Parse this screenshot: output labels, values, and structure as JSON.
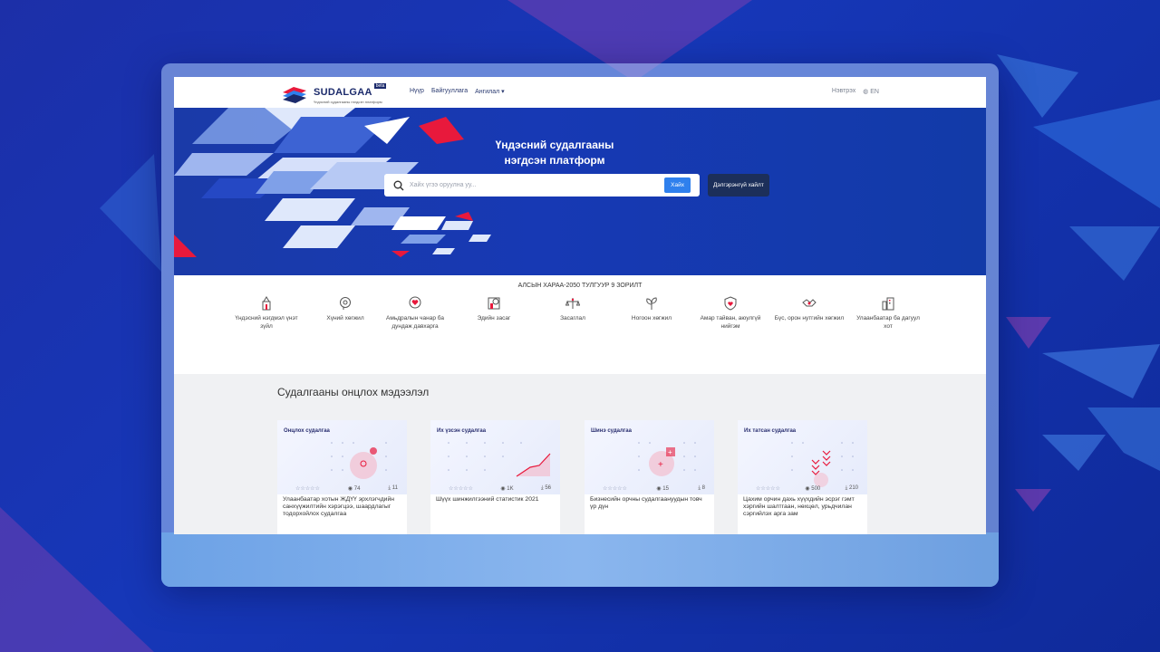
{
  "header": {
    "logo_name": "SUDALGAA",
    "logo_badge": "beta",
    "logo_tagline": "Үндэсний судалгааны нэгдсэн платформ",
    "nav": [
      "Нүүр",
      "Байгууллага",
      "Ангилал ▾"
    ],
    "login": "Нэвтрэх",
    "language": "EN"
  },
  "hero": {
    "title_line1": "Үндэсний судалгааны",
    "title_line2": "нэгдсэн платформ",
    "search_placeholder": "Хайх үгээ оруулна уу...",
    "search_button": "Хайх",
    "advanced_button": "Дэлгэрэнгүй хайлт"
  },
  "goals": {
    "title": "АЛСЫН ХАРАА-2050 ТУЛГУУР 9 ЗОРИЛТ",
    "items": [
      {
        "label": "Үндэсний нэгдмэл үнэт зүйл",
        "icon": "monument-icon"
      },
      {
        "label": "Хүний хөгжил",
        "icon": "head-icon"
      },
      {
        "label": "Амьдралын чанар ба дундаж давхарга",
        "icon": "hands-heart-icon"
      },
      {
        "label": "Эдийн засаг",
        "icon": "coins-icon"
      },
      {
        "label": "Засаглал",
        "icon": "scales-icon"
      },
      {
        "label": "Ногоон хөгжил",
        "icon": "leaf-icon"
      },
      {
        "label": "Амар тайван, аюулгүй нийгэм",
        "icon": "shield-icon"
      },
      {
        "label": "Бүс, орон нутгийн хөгжил",
        "icon": "handshake-icon"
      },
      {
        "label": "Улаанбаатар ба дагуул хот",
        "icon": "city-icon"
      }
    ]
  },
  "trending": {
    "title": "Судалгааны онцлох мэдээлэл",
    "cards": [
      {
        "label": "Онцлох судалгаа",
        "views": "74",
        "downloads": "11",
        "text": "Улаанбаатар хотын ЖДҮҮ эрхлэгчдийн санхүүжилтийн хэрэгцээ, шаардлагыг тодорхойлох судалгаа"
      },
      {
        "label": "Их үзсэн судалгаа",
        "views": "1K",
        "downloads": "56",
        "text": "Шүүх шинжилгээний статистик 2021"
      },
      {
        "label": "Шинэ судалгаа",
        "views": "15",
        "downloads": "8",
        "text": "Бизнесийн орчны судалгаануудын товч үр дүн"
      },
      {
        "label": "Их татсан судалгаа",
        "views": "500",
        "downloads": "210",
        "text": "Цахим орчин дахь хүүхдийн эсрэг гэмт хэргийн шалтгаан, нөхцөл, урьдчилан сэргийлэх арга зам"
      }
    ]
  },
  "colors": {
    "background": "#1637b8",
    "hero": "#1739b4",
    "accent_red": "#e8193c",
    "button_blue": "#2f80ed",
    "advanced_button": "#1c2f5a"
  }
}
